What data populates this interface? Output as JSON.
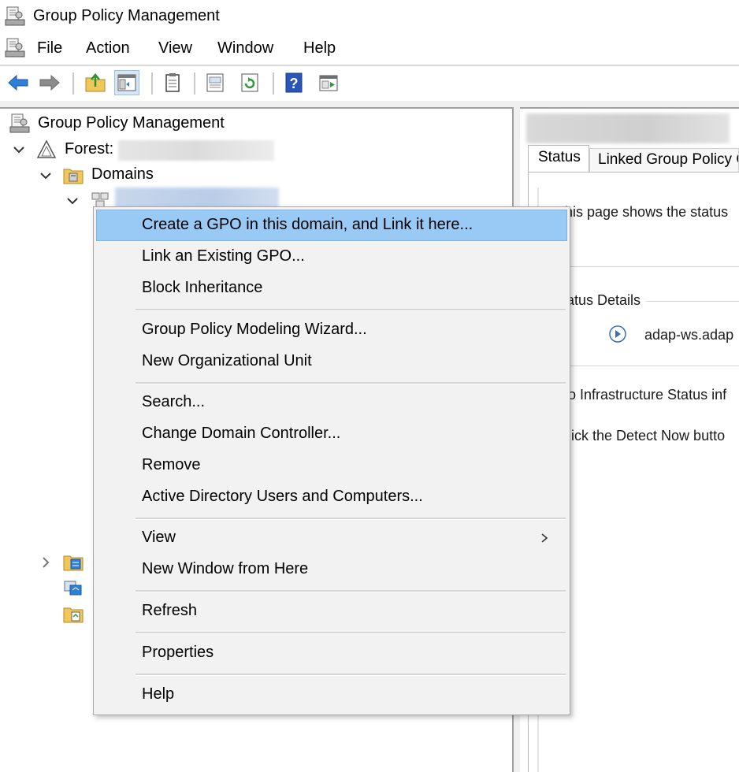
{
  "window": {
    "title": "Group Policy Management"
  },
  "menubar": {
    "items": [
      "File",
      "Action",
      "View",
      "Window",
      "Help"
    ]
  },
  "toolbar": {
    "buttons": [
      "back-icon",
      "forward-icon",
      "up-folder-icon",
      "show-hide-tree-icon",
      "clipboard-icon",
      "properties-icon",
      "refresh-icon",
      "help-icon",
      "console-icon"
    ]
  },
  "tree": {
    "root": "Group Policy Management",
    "forest_label": "Forest:",
    "domains_label": "Domains"
  },
  "right_pane": {
    "tabs": {
      "status": "Status",
      "linked": "Linked Group Policy O"
    },
    "line1": "This page shows the status",
    "status_details": "Status Details",
    "dc_name": "adap-ws.adap",
    "line2": "No Infrastructure Status inf",
    "line3": "Click the Detect Now butto"
  },
  "context_menu": {
    "items": [
      {
        "label": "Create a GPO in this domain, and Link it here...",
        "highlighted": true
      },
      {
        "label": "Link an Existing GPO..."
      },
      {
        "label": "Block Inheritance"
      },
      {
        "label": "Group Policy Modeling Wizard..."
      },
      {
        "label": "New Organizational Unit"
      },
      {
        "label": "Search..."
      },
      {
        "label": "Change Domain Controller..."
      },
      {
        "label": "Remove"
      },
      {
        "label": "Active Directory Users and Computers..."
      },
      {
        "label": "View",
        "submenu": true
      },
      {
        "label": "New Window from Here"
      },
      {
        "label": "Refresh"
      },
      {
        "label": "Properties"
      },
      {
        "label": "Help"
      }
    ]
  },
  "colors": {
    "highlight": "#99c9f5",
    "menu_bg": "#f2f2f2",
    "toolbar_arrow": "#2f7fd8"
  }
}
